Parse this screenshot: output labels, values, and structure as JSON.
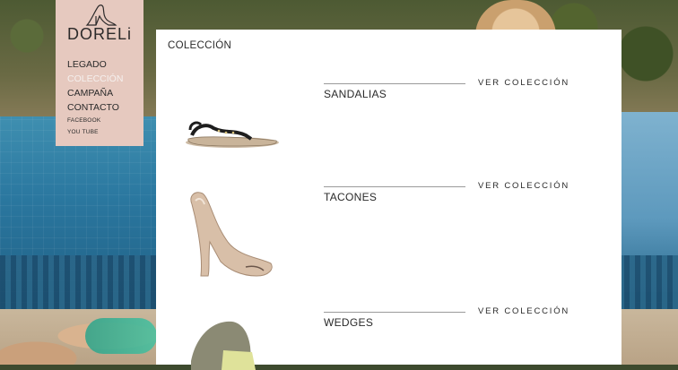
{
  "brand": {
    "logo_text": "DORELi"
  },
  "nav": {
    "items": [
      {
        "label": "LEGADO",
        "active": false
      },
      {
        "label": "COLECCIÓN",
        "active": true
      },
      {
        "label": "CAMPAÑA",
        "active": false
      },
      {
        "label": "CONTACTO",
        "active": false
      },
      {
        "label": "FACEBOOK",
        "active": false
      },
      {
        "label": "YOU TUBE",
        "active": false
      }
    ]
  },
  "content": {
    "title": "COLECCIÓN",
    "products": [
      {
        "name": "SANDALIAS",
        "link": "VER COLECCIÓN",
        "image": "black-flat-sandal-icon"
      },
      {
        "name": "TACONES",
        "link": "VER COLECCIÓN",
        "image": "nude-peep-toe-heel-icon"
      },
      {
        "name": "WEDGES",
        "link": "VER COLECCIÓN",
        "image": "wedge-shoe-icon"
      }
    ]
  },
  "colors": {
    "nav_panel": "#e6c9bf",
    "active_nav": "#f5f0ee",
    "text": "#2a2a2a"
  }
}
